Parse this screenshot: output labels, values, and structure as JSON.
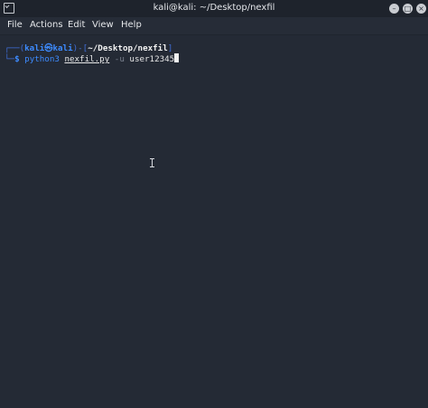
{
  "window": {
    "title": "kali@kali: ~/Desktop/nexfil",
    "app_icon": "terminal-icon",
    "controls": {
      "minimize_icon": "minimize-icon",
      "maximize_icon": "maximize-icon",
      "close_icon": "close-icon",
      "minimize_symbol": "–",
      "maximize_symbol": "□",
      "close_symbol": "×"
    }
  },
  "menu": {
    "file": "File",
    "actions": "Actions",
    "edit": "Edit",
    "view": "View",
    "help": "Help"
  },
  "terminal": {
    "prompt": {
      "corner_top": "┌──(",
      "user": "kali",
      "at": "㉿",
      "host": "kali",
      "sep": ")-[",
      "path": "~/Desktop/nexfil",
      "close": "]",
      "corner_bottom": "└─",
      "symbol": "$"
    },
    "command": {
      "program": "python3",
      "script": "nexfil.py",
      "flag": "-u",
      "value": "user12345"
    }
  },
  "colors": {
    "background": "#242a35",
    "titlebar": "#1e232c",
    "prompt_blue": "#3d8bff",
    "frame_blue": "#3f6dd7"
  }
}
